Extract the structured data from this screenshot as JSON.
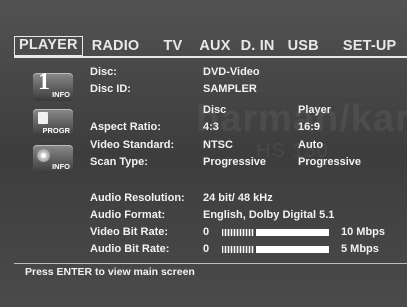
{
  "tabs": [
    "PLAYER",
    "RADIO",
    "TV",
    "AUX",
    "D. IN",
    "USB",
    "SET-UP"
  ],
  "icons": {
    "info_label": "INFO",
    "info_glyph": "1",
    "progr_label": "PROGR",
    "info2_label": "INFO"
  },
  "disc": {
    "disc_label": "Disc:",
    "disc_value": "DVD-Video",
    "disc_id_label": "Disc ID:",
    "disc_id_value": "SAMPLER"
  },
  "compare": {
    "col_disc": "Disc",
    "col_player": "Player",
    "rows": [
      {
        "label": "Aspect Ratio:",
        "disc": "4:3",
        "player": "16:9"
      },
      {
        "label": "Video Standard:",
        "disc": "NTSC",
        "player": "Auto"
      },
      {
        "label": "Scan Type:",
        "disc": "Progressive",
        "player": "Progressive"
      }
    ]
  },
  "audio": {
    "resolution_label": "Audio Resolution:",
    "resolution_value": "24 bit/ 48 kHz",
    "format_label": "Audio Format:",
    "format_value": "English, Dolby Digital 5.1"
  },
  "bitrate": {
    "video_label": "Video Bit Rate:",
    "video_min": "0",
    "video_max": "10 Mbps",
    "video_level": 0.3,
    "audio_label": "Audio Bit Rate:",
    "audio_min": "0",
    "audio_max": "5 Mbps",
    "audio_level": 0.3
  },
  "footer": "Press ENTER to view main screen",
  "watermark": {
    "brand": "harman/kardon",
    "model": "HS 150"
  }
}
